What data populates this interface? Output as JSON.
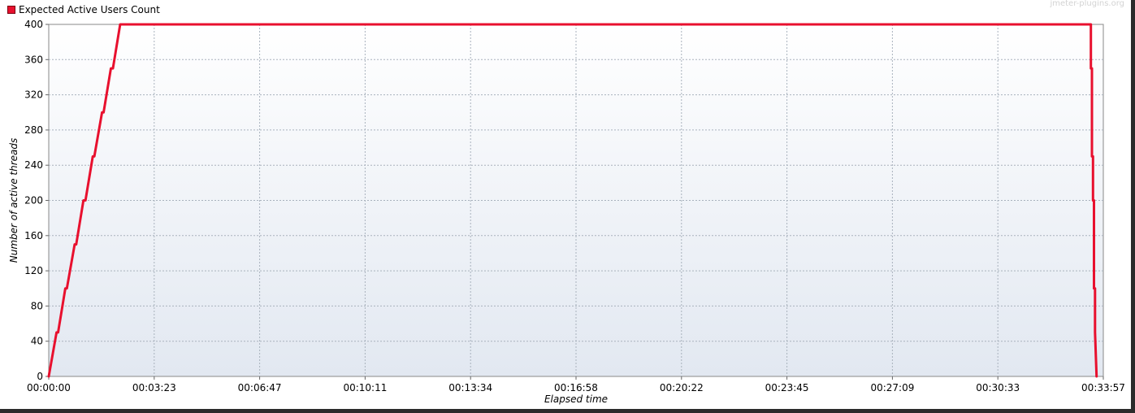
{
  "watermark": "jmeter-plugins.org",
  "colors": {
    "series": "#e8102e",
    "grid": "#a9b2bd",
    "plot_top": "#ffffff",
    "plot_bottom": "#e2e8f1"
  },
  "chart_data": {
    "type": "line",
    "xlabel": "Elapsed time",
    "ylabel": "Number of active threads",
    "ylim": [
      0,
      400
    ],
    "xlim_seconds": [
      0,
      2037
    ],
    "grid": true,
    "legend_position": "top-left",
    "y_ticks": [
      "0",
      "40",
      "80",
      "120",
      "160",
      "200",
      "240",
      "280",
      "320",
      "360",
      "400"
    ],
    "x_ticks": [
      "00:00:00",
      "00:03:23",
      "00:06:47",
      "00:10:11",
      "00:13:34",
      "00:16:58",
      "00:20:22",
      "00:23:45",
      "00:27:09",
      "00:30:33",
      "00:33:57"
    ],
    "series": [
      {
        "name": "Expected Active Users Count",
        "color": "#e8102e",
        "x": [
          0,
          15,
          18,
          32,
          35,
          50,
          53,
          67,
          71,
          85,
          88,
          103,
          106,
          120,
          124,
          138,
          141,
          155,
          2009,
          2013,
          2013,
          2015,
          2015,
          2017,
          2017,
          2019,
          2019,
          2021,
          2021,
          2024
        ],
        "y": [
          0,
          50,
          50,
          100,
          100,
          150,
          150,
          200,
          200,
          250,
          250,
          300,
          300,
          350,
          350,
          400,
          400,
          400,
          400,
          400,
          350,
          350,
          250,
          250,
          200,
          200,
          100,
          100,
          50,
          0
        ]
      }
    ]
  }
}
